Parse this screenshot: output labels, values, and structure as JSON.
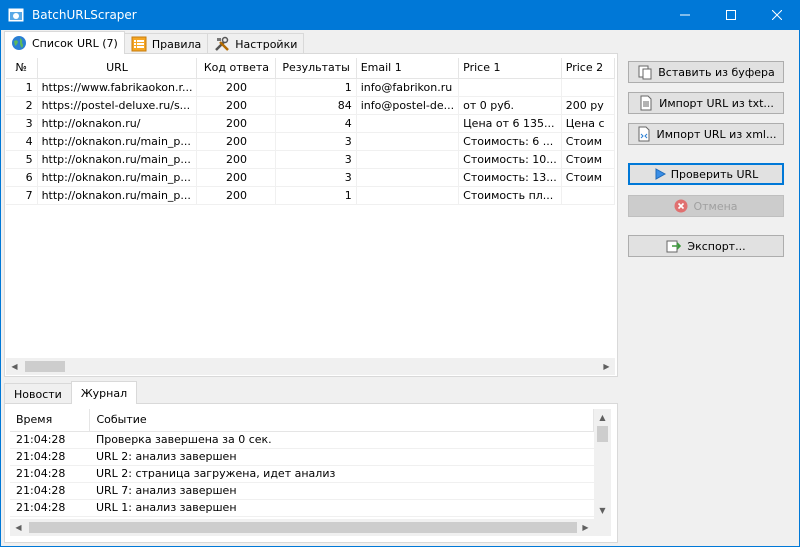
{
  "window": {
    "title": "BatchURLScraper"
  },
  "tabs": [
    {
      "label": "Список URL (7)"
    },
    {
      "label": "Правила"
    },
    {
      "label": "Настройки"
    }
  ],
  "grid": {
    "headers": [
      "№",
      "URL",
      "Код ответа",
      "Результаты",
      "Email 1",
      "Price 1",
      "Price 2"
    ],
    "rows": [
      [
        "1",
        "https://www.fabrikaokon.r...",
        "200",
        "1",
        "info@fabrikon.ru",
        "",
        ""
      ],
      [
        "2",
        "https://postel-deluxe.ru/s...",
        "200",
        "84",
        "info@postel-de...",
        "от 0 руб.",
        "200 ру"
      ],
      [
        "3",
        "http://oknakon.ru/",
        "200",
        "4",
        "",
        "Цена от 6 135...",
        "Цена с"
      ],
      [
        "4",
        "http://oknakon.ru/main_p...",
        "200",
        "3",
        "",
        "Стоимость: 6 ...",
        "Стоим"
      ],
      [
        "5",
        "http://oknakon.ru/main_p...",
        "200",
        "3",
        "",
        "Стоимость: 10...",
        "Стоим"
      ],
      [
        "6",
        "http://oknakon.ru/main_p...",
        "200",
        "3",
        "",
        "Стоимость: 13...",
        "Стоим"
      ],
      [
        "7",
        "http://oknakon.ru/main_p...",
        "200",
        "1",
        "",
        "Стоимость пл...",
        ""
      ]
    ]
  },
  "buttons": {
    "paste": "Вставить из буфера",
    "import_txt": "Импорт URL из txt...",
    "import_xml": "Импорт URL из xml...",
    "check": "Проверить URL",
    "cancel": "Отмена",
    "export": "Экспорт..."
  },
  "bottom_tabs": [
    {
      "label": "Новости"
    },
    {
      "label": "Журнал"
    }
  ],
  "log": {
    "headers": [
      "Время",
      "Событие"
    ],
    "rows": [
      [
        "21:04:28",
        "Проверка завершена за 0 сек."
      ],
      [
        "21:04:28",
        "URL 2: анализ завершен"
      ],
      [
        "21:04:28",
        "URL 2: страница загружена, идет анализ"
      ],
      [
        "21:04:28",
        "URL 7: анализ завершен"
      ],
      [
        "21:04:28",
        "URL 1: анализ завершен"
      ]
    ]
  },
  "colors": {
    "titlebar": "#0078d7",
    "accent": "#0078d7",
    "cancel_icon": "#d9534f"
  }
}
